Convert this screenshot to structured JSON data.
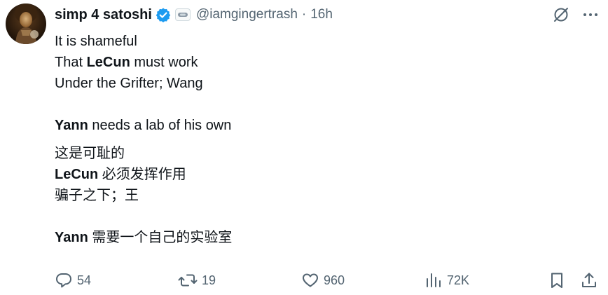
{
  "tweet": {
    "author": {
      "display_name": "simp 4 satoshi",
      "handle": "@iamgingertrash",
      "verified": true
    },
    "separator": "·",
    "timestamp": "16h",
    "lines": [
      {
        "parts": [
          {
            "text": "It is shameful",
            "bold": false
          }
        ]
      },
      {
        "parts": [
          {
            "text": "That ",
            "bold": false
          },
          {
            "text": "LeCun",
            "bold": true
          },
          {
            "text": " must work",
            "bold": false
          }
        ]
      },
      {
        "parts": [
          {
            "text": "Under the Grifter; Wang",
            "bold": false
          }
        ]
      },
      {
        "parts": [
          {
            "text": "Yann",
            "bold": true
          },
          {
            "text": " needs a lab of his own",
            "bold": false
          }
        ]
      },
      {
        "parts": [
          {
            "text": "这是可耻的",
            "bold": false
          }
        ]
      },
      {
        "parts": [
          {
            "text": "LeCun",
            "bold": true
          },
          {
            "text": " 必须发挥作用",
            "bold": false
          }
        ]
      },
      {
        "parts": [
          {
            "text": "骗子之下；王",
            "bold": false
          }
        ]
      },
      {
        "parts": [
          {
            "text": "Yann",
            "bold": true
          },
          {
            "text": " 需要一个自己的实验室",
            "bold": false
          }
        ]
      }
    ]
  },
  "metrics": {
    "replies": "54",
    "reposts": "19",
    "likes": "960",
    "views": "72K"
  },
  "icons": {
    "avatar": "avatar",
    "verified": "verified-badge-icon",
    "affiliate": "affiliate-badge-icon",
    "grok": "grok-icon",
    "more": "more-icon",
    "reply": "reply-icon",
    "repost": "repost-icon",
    "like": "heart-icon",
    "views": "views-icon",
    "bookmark": "bookmark-icon",
    "share": "share-icon"
  },
  "colors": {
    "text": "#0f1419",
    "secondary": "#536471",
    "verified_blue": "#1d9bf0"
  }
}
